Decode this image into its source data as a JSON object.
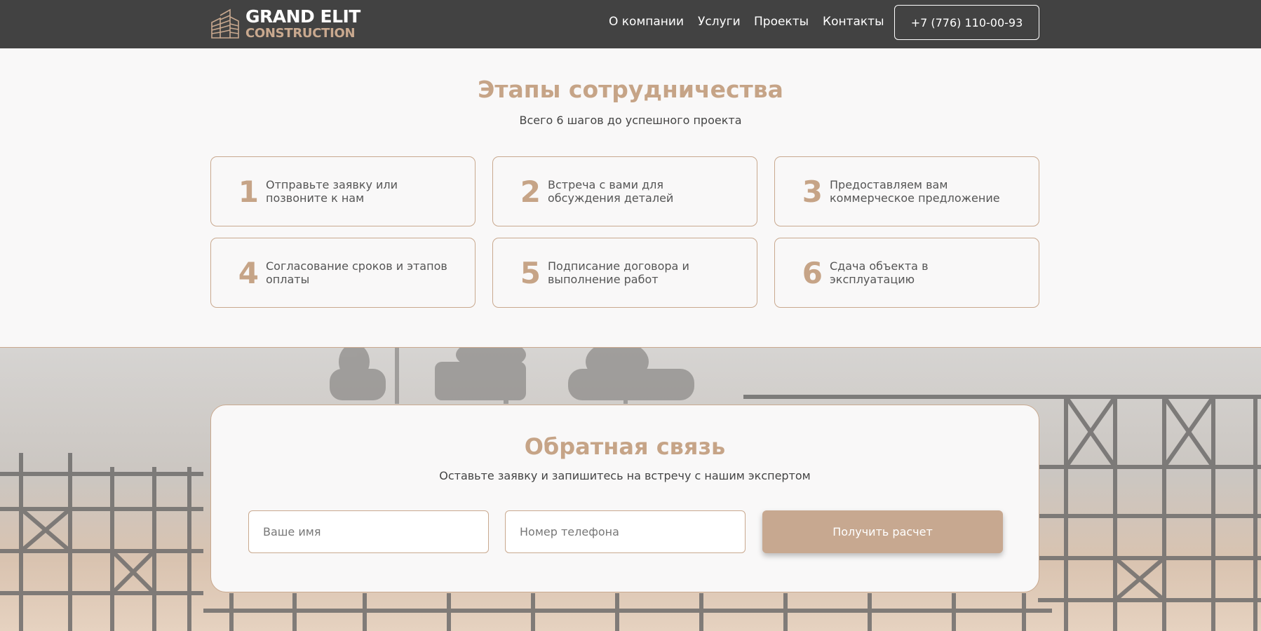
{
  "header": {
    "logo_line1": "GRAND ELIT",
    "logo_line2": "CONSTRUCTION",
    "nav": [
      "О компании",
      "Услуги",
      "Проекты",
      "Контакты"
    ],
    "phone": "+7 (776) 110-00-93"
  },
  "stages": {
    "title": "Этапы сотрудничества",
    "subtitle": "Всего 6 шагов до успешного проекта",
    "steps": [
      {
        "num": "1",
        "text": "Отправьте заявку или позвоните к нам"
      },
      {
        "num": "2",
        "text": "Встреча с вами для обсуждения деталей"
      },
      {
        "num": "3",
        "text": "Предоставляем вам коммерческое предложение"
      },
      {
        "num": "4",
        "text": "Согласование сроков и этапов оплаты"
      },
      {
        "num": "5",
        "text": "Подписание договора и выполнение работ"
      },
      {
        "num": "6",
        "text": "Сдача объекта в эксплуатацию"
      }
    ]
  },
  "feedback": {
    "title": "Обратная связь",
    "subtitle": "Оставьте заявку и запишитесь на встречу с нашим экспертом",
    "name_placeholder": "Ваше имя",
    "phone_placeholder": "Номер телефона",
    "submit_label": "Получить расчет"
  },
  "colors": {
    "header_bg": "#424242",
    "accent": "#c6a487",
    "page_bg": "#f9f8f8"
  }
}
